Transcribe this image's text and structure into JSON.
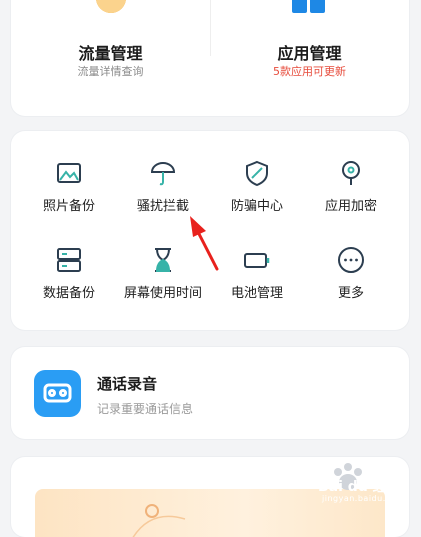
{
  "top": {
    "flow": {
      "title": "流量管理",
      "subtitle": "流量详情查询",
      "icon": "data-usage-icon"
    },
    "apps": {
      "title": "应用管理",
      "subtitle": "5款应用可更新",
      "icon": "app-grid-icon"
    }
  },
  "grid": [
    {
      "label": "照片备份",
      "icon": "photo-backup-icon"
    },
    {
      "label": "骚扰拦截",
      "icon": "umbrella-icon"
    },
    {
      "label": "防骗中心",
      "icon": "shield-slash-icon"
    },
    {
      "label": "应用加密",
      "icon": "keyhole-icon"
    },
    {
      "label": "数据备份",
      "icon": "database-icon"
    },
    {
      "label": "屏幕使用时间",
      "icon": "hourglass-icon"
    },
    {
      "label": "电池管理",
      "icon": "battery-icon"
    },
    {
      "label": "更多",
      "icon": "more-icon"
    }
  ],
  "record": {
    "title": "通话录音",
    "subtitle": "记录重要通话信息",
    "icon": "voicemail-icon"
  },
  "watermark": {
    "text": "Bai du 经验",
    "sub": "jingyan.baidu.com"
  },
  "colors": {
    "accent": "#2a9df4",
    "teal": "#37b3a8",
    "alert": "#e74c3c",
    "arrow": "#e8211d"
  }
}
